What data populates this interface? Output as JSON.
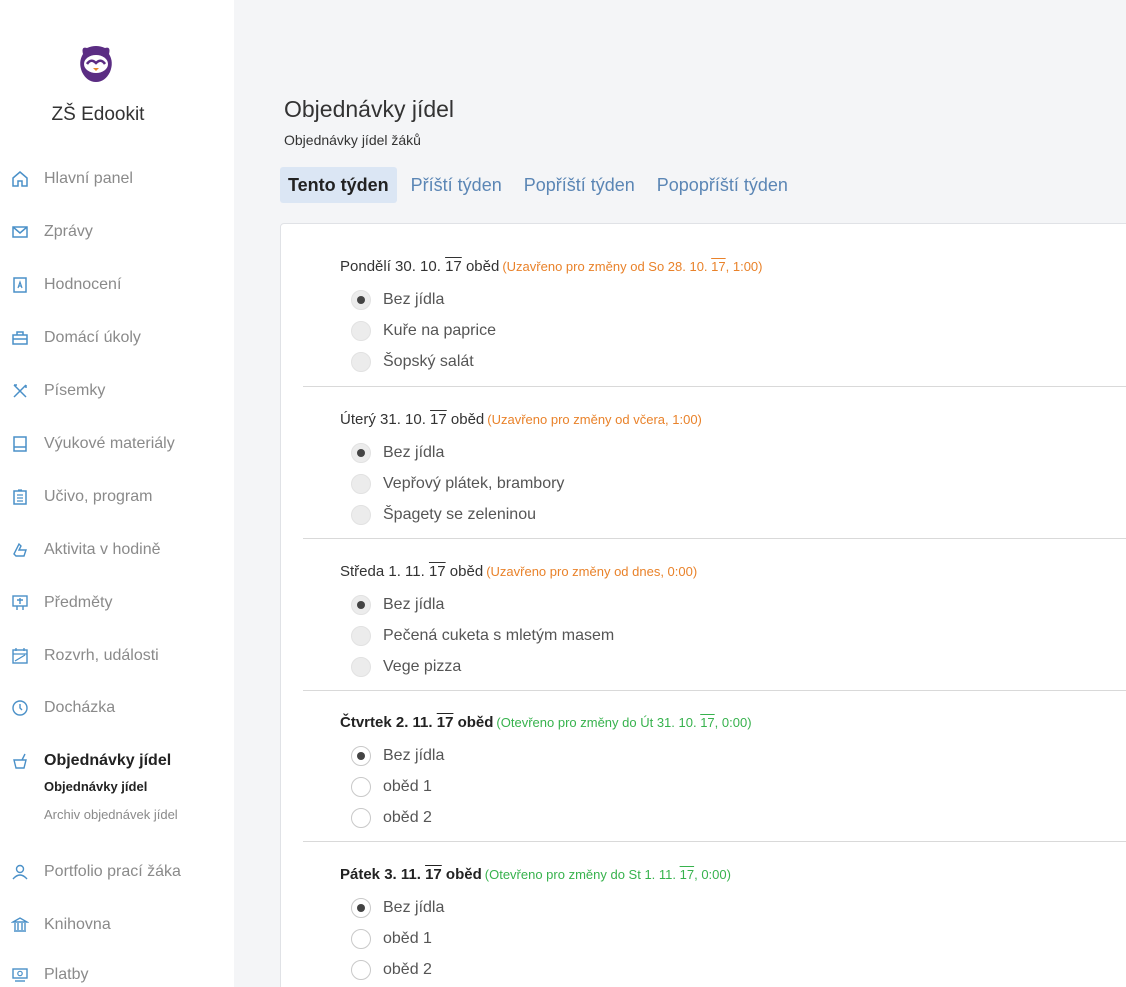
{
  "school": {
    "name": "ZŠ Edookit"
  },
  "sidebar": {
    "items": [
      {
        "label": "Hlavní panel",
        "icon": "home-icon"
      },
      {
        "label": "Zprávy",
        "icon": "envelope-icon"
      },
      {
        "label": "Hodnocení",
        "icon": "grade-icon"
      },
      {
        "label": "Domácí úkoly",
        "icon": "briefcase-icon"
      },
      {
        "label": "Písemky",
        "icon": "pencils-icon"
      },
      {
        "label": "Výukové materiály",
        "icon": "book-icon"
      },
      {
        "label": "Učivo, program",
        "icon": "clipboard-icon"
      },
      {
        "label": "Aktivita v hodině",
        "icon": "hand-icon"
      },
      {
        "label": "Předměty",
        "icon": "subjects-icon"
      },
      {
        "label": "Rozvrh, události",
        "icon": "calendar-icon"
      },
      {
        "label": "Docházka",
        "icon": "clock-icon"
      },
      {
        "label": "Objednávky jídel",
        "icon": "meal-icon",
        "active": true
      },
      {
        "label": "Portfolio prací žáka",
        "icon": "user-icon"
      },
      {
        "label": "Knihovna",
        "icon": "library-icon"
      },
      {
        "label": "Platby",
        "icon": "payments-icon"
      }
    ],
    "subitems": [
      {
        "label": "Objednávky jídel",
        "active": true
      },
      {
        "label": "Archiv objednávek jídel"
      }
    ]
  },
  "page": {
    "title": "Objednávky jídel",
    "subtitle": "Objednávky jídel žáků"
  },
  "tabs": [
    {
      "label": "Tento týden",
      "active": true
    },
    {
      "label": "Příští týden"
    },
    {
      "label": "Popříští týden"
    },
    {
      "label": "Popopříští týden"
    }
  ],
  "days": [
    {
      "prefix": "Pondělí 30. 10. ",
      "year": "17",
      "meal": " oběd",
      "status": "(Uzavřeno pro změny od So 28. 10. ",
      "status_year": "17",
      "status_end": ", 1:00)",
      "open": false,
      "options": [
        "Bez jídla",
        "Kuře na paprice",
        "Šopský salát"
      ],
      "selected": 0
    },
    {
      "prefix": "Úterý 31. 10. ",
      "year": "17",
      "meal": " oběd",
      "status": "(Uzavřeno pro změny od včera, 1:00)",
      "status_year": "",
      "status_end": "",
      "open": false,
      "options": [
        "Bez jídla",
        "Vepřový plátek, brambory",
        "Špagety se zeleninou"
      ],
      "selected": 0
    },
    {
      "prefix": "Středa 1. 11. ",
      "year": "17",
      "meal": " oběd",
      "status": "(Uzavřeno pro změny od dnes, 0:00)",
      "status_year": "",
      "status_end": "",
      "open": false,
      "options": [
        "Bez jídla",
        "Pečená cuketa s mletým masem",
        "Vege pizza"
      ],
      "selected": 0
    },
    {
      "prefix": "Čtvrtek 2. 11. ",
      "year": "17",
      "meal": " oběd",
      "status": "(Otevřeno pro změny do Út 31. 10. ",
      "status_year": "17",
      "status_end": ", 0:00)",
      "open": true,
      "options": [
        "Bez jídla",
        "oběd 1",
        "oběd 2"
      ],
      "selected": 0
    },
    {
      "prefix": "Pátek 3. 11. ",
      "year": "17",
      "meal": " oběd",
      "status": "(Otevřeno pro změny do St 1. 11. ",
      "status_year": "17",
      "status_end": ", 0:00)",
      "open": true,
      "options": [
        "Bez jídla",
        "oběd 1",
        "oběd 2"
      ],
      "selected": 0
    }
  ],
  "colors": {
    "closed_status": "#e9822a",
    "open_status": "#37b24d",
    "tab_link": "#5b86b5",
    "tab_active_bg": "#dbe6f4"
  }
}
